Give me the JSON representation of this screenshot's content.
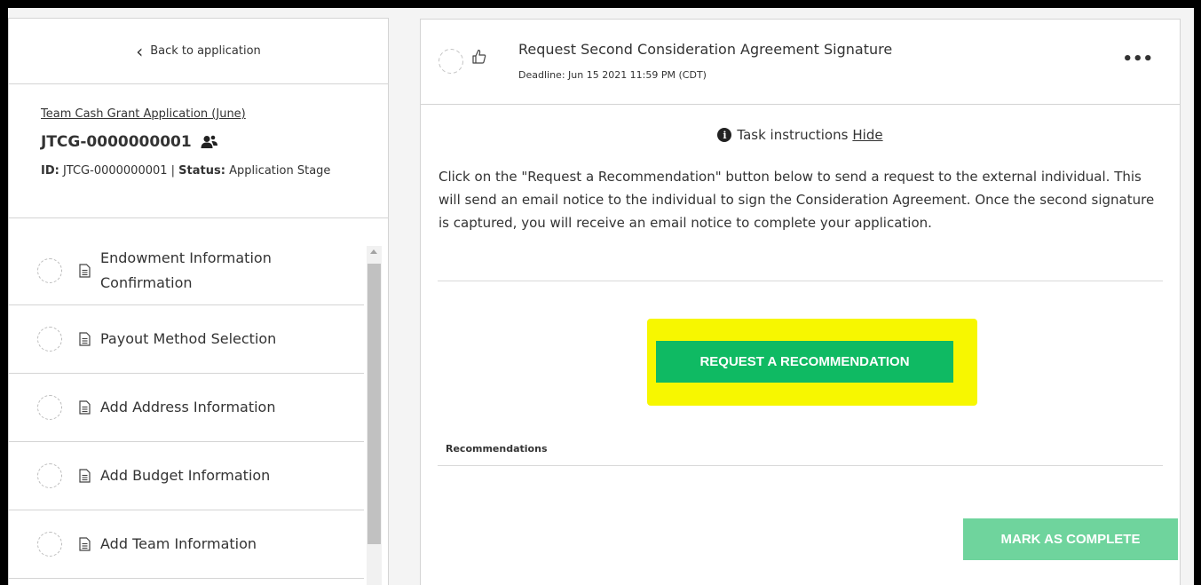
{
  "sidebar": {
    "back_label": "Back to application",
    "app_link": "Team Cash Grant Application (June)",
    "app_id": "JTCG-0000000001",
    "meta_id_label": "ID:",
    "meta_id_value": " JTCG-0000000001 | ",
    "meta_status_label": "Status:",
    "meta_status_value": " Application Stage",
    "tasks": [
      {
        "label": "Endowment Information Confirmation"
      },
      {
        "label": "Payout Method Selection"
      },
      {
        "label": "Add Address Information"
      },
      {
        "label": "Add Budget Information"
      },
      {
        "label": "Add Team Information"
      }
    ]
  },
  "task": {
    "title": "Request Second Consideration Agreement Signature",
    "deadline": "Deadline: Jun 15 2021 11:59 PM (CDT)",
    "more_label": "•••",
    "instructions_heading": "Task instructions",
    "hide_label": "Hide",
    "instructions_body": "Click on the \"Request a Recommendation\" button below to send a request to the external individual. This will send an email notice to the individual to sign the Consideration Agreement. Once the second signature is captured, you will receive an email notice to complete your application.",
    "request_button": "REQUEST A RECOMMENDATION",
    "recommendations_label": "Recommendations",
    "complete_button": "MARK AS COMPLETE"
  },
  "colors": {
    "primary_button": "#0fba63",
    "disabled_button": "#6fd49d",
    "highlight": "#f7f700"
  },
  "icons": [
    "chevron-left-icon",
    "people-icon",
    "document-icon",
    "thumbs-up-icon",
    "info-icon",
    "more-icon"
  ]
}
